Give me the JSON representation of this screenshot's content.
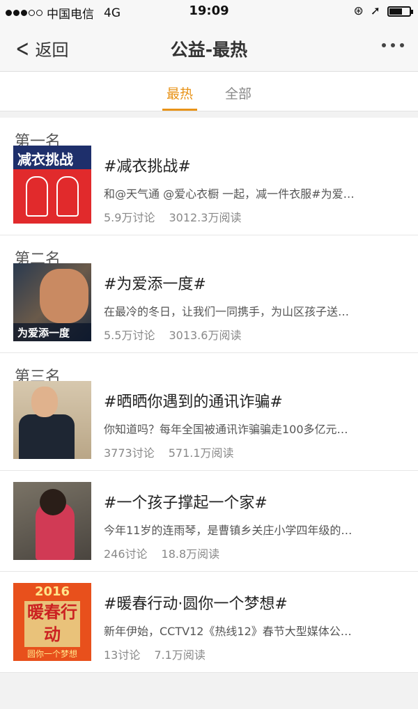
{
  "status_bar": {
    "carrier": "中国电信",
    "network": "4G",
    "time": "19:09"
  },
  "nav": {
    "back_label": "返回",
    "title": "公益-最热"
  },
  "tabs": [
    {
      "label": "最热",
      "active": true
    },
    {
      "label": "全部",
      "active": false
    }
  ],
  "accent_color": "#e89318",
  "items": [
    {
      "rank": "第一名",
      "title": "#减衣挑战#",
      "desc": "和@天气通 @爱心衣橱 一起，减一件衣服#为爱…",
      "discussions": "5.9万讨论",
      "reads": "3012.3万阅读",
      "thumb_text": "减衣挑战"
    },
    {
      "rank": "第二名",
      "title": "#为爱添一度#",
      "desc": "在最冷的冬日，让我们一同携手，为山区孩子送…",
      "discussions": "5.5万讨论",
      "reads": "3013.6万阅读",
      "thumb_text": "为爱添一度"
    },
    {
      "rank": "第三名",
      "title": "#晒晒你遇到的通讯诈骗#",
      "desc": "你知道吗？每年全国被通讯诈骗骗走100多亿元…",
      "discussions": "3773讨论",
      "reads": "571.1万阅读"
    },
    {
      "rank": "",
      "title": "#一个孩子撑起一个家#",
      "desc": "今年11岁的连雨琴，是曹镇乡关庄小学四年级的…",
      "discussions": "246讨论",
      "reads": "18.8万阅读"
    },
    {
      "rank": "",
      "title": "#暖春行动·圆你一个梦想#",
      "desc": "新年伊始，CCTV12《热线12》春节大型媒体公…",
      "discussions": "13讨论",
      "reads": "7.1万阅读",
      "thumb_year": "2016",
      "thumb_text": "暖春行动",
      "thumb_sub": "圆你一个梦想"
    }
  ]
}
